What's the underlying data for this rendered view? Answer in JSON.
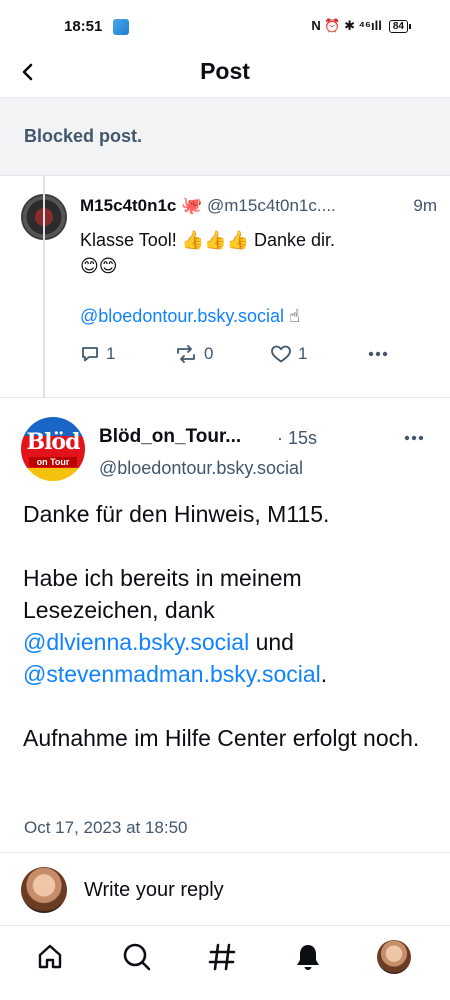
{
  "status_bar": {
    "time": "18:51",
    "indicators": "N ⏰ ✱ ⁴⁶ıll",
    "battery": "84"
  },
  "header": {
    "title": "Post"
  },
  "blocked_post": {
    "label": "Blocked post."
  },
  "reply_post": {
    "author_name": "M15c4t0n1c 🐙",
    "author_handle": "@m15c4t0n1c....",
    "time": "9m",
    "text_line1": "Klasse Tool! 👍👍👍 Danke dir.",
    "text_line2": "😊😊",
    "mention": "@bloedontour.bsky.social",
    "mention_suffix": " ☝",
    "reply_count": "1",
    "repost_count": "0",
    "like_count": "1"
  },
  "main_post": {
    "author_name": "Blöd_on_Tour...",
    "time": "· 15s",
    "author_handle": "@bloedontour.bsky.social",
    "avatar_text_top": "Blöd",
    "avatar_text_bottom": "on Tour",
    "para1": "Danke für den Hinweis, M115.",
    "para2_start": "Habe ich bereits in meinem Lesezeichen, dank ",
    "mention1": "@dlvienna.bsky.social",
    "para2_mid": " und ",
    "mention2": "@stevenmadman.bsky.social",
    "para2_end": ".",
    "para3": "Aufnahme im Hilfe Center erfolgt noch.",
    "date": "Oct 17, 2023 at 18:50"
  },
  "reply_bar": {
    "placeholder": "Write your reply"
  },
  "bottom_nav": {
    "items": [
      "home-icon",
      "search-icon",
      "hashtag-icon",
      "bell-icon",
      "profile-avatar"
    ]
  },
  "colors": {
    "accent": "#1083fe",
    "muted_text": "#42576c",
    "blocked_bg": "#f1f3f5",
    "border": "#e3e6ea"
  }
}
